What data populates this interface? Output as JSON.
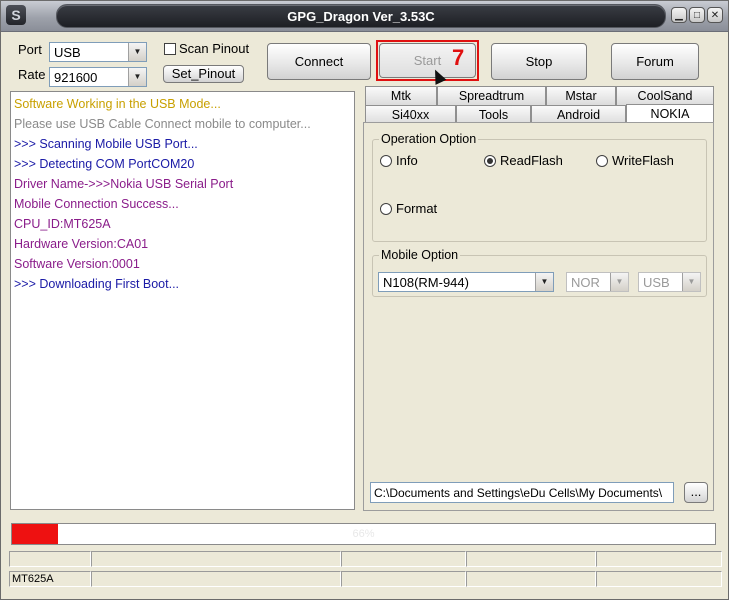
{
  "window": {
    "title": "GPG_Dragon  Ver_3.53C",
    "logo_icon": "app-logo-icon",
    "controls": [
      "minimize-icon",
      "maximize-icon",
      "close-icon"
    ]
  },
  "connection": {
    "port_label": "Port",
    "port_value": "USB",
    "rate_label": "Rate",
    "rate_value": "921600",
    "scan_pinout_label": "Scan Pinout",
    "scan_pinout_checked": false,
    "set_pinout_label": "Set_Pinout"
  },
  "toolbar": {
    "connect_label": "Connect",
    "start_label": "Start",
    "start_badge": "7",
    "stop_label": "Stop",
    "forum_label": "Forum"
  },
  "log": {
    "lines": [
      {
        "text": "Software Working in the USB Mode...",
        "color": "#c8a000"
      },
      {
        "text": "Please use USB Cable Connect mobile to computer...",
        "color": "#8a8a8a"
      },
      {
        "text": ">>> Scanning Mobile USB Port...",
        "color": "#1a1aa6"
      },
      {
        "text": ">>> Detecting COM PortCOM20",
        "color": "#1a1aa6"
      },
      {
        "text": "Driver Name->>>Nokia USB Serial Port",
        "color": "#8a1c8a"
      },
      {
        "text": "Mobile Connection Success...",
        "color": "#8a1c8a"
      },
      {
        "text": "CPU_ID:MT625A",
        "color": "#8a1c8a"
      },
      {
        "text": "Hardware Version:CA01",
        "color": "#8a1c8a"
      },
      {
        "text": "Software Version:0001",
        "color": "#8a1c8a"
      },
      {
        "text": ">>> Downloading First Boot...",
        "color": "#1a1aa6"
      }
    ]
  },
  "tabs": {
    "row1": [
      "Mtk",
      "Spreadtrum",
      "Mstar",
      "CoolSand"
    ],
    "row2": [
      "Si40xx",
      "Tools",
      "Android",
      "NOKIA"
    ],
    "active": "NOKIA"
  },
  "operation": {
    "title": "Operation Option",
    "options": [
      "Info",
      "ReadFlash",
      "WriteFlash",
      "Format"
    ],
    "selected": "ReadFlash"
  },
  "mobile": {
    "title": "Mobile Option",
    "model": "N108(RM-944)",
    "memory": "NOR",
    "interface": "USB"
  },
  "file": {
    "path": "C:\\Documents and Settings\\eDu Cells\\My Documents\\",
    "browse_label": "..."
  },
  "progress": {
    "percent": 66,
    "text": "66%"
  },
  "status": {
    "cpu": "MT625A"
  }
}
